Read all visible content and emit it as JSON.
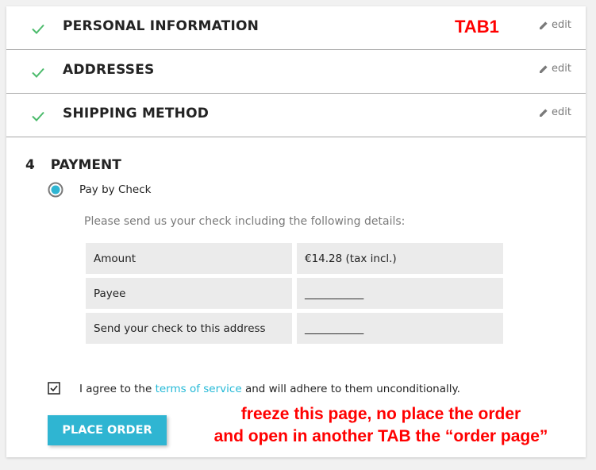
{
  "annotation": {
    "tab_label": "TAB1",
    "note_line1": "freeze this page, no place the order",
    "note_line2": "and open in another TAB the “order page”"
  },
  "steps": [
    {
      "title": "PERSONAL INFORMATION",
      "edit_label": "edit",
      "status_icon": "check-icon"
    },
    {
      "title": "ADDRESSES",
      "edit_label": "edit",
      "status_icon": "check-icon"
    },
    {
      "title": "SHIPPING METHOD",
      "edit_label": "edit",
      "status_icon": "check-icon"
    }
  ],
  "payment": {
    "number": "4",
    "title": "PAYMENT",
    "option_label": "Pay by Check",
    "option_selected": true,
    "description": "Please send us your check including the following details:",
    "details": [
      {
        "label": "Amount",
        "value": "€14.28 (tax incl.)"
      },
      {
        "label": "Payee",
        "value": "___________"
      },
      {
        "label": "Send your check to this address",
        "value": "___________"
      }
    ],
    "terms": {
      "checked": true,
      "prefix": "I agree to the",
      "link": "terms of service",
      "suffix": "and will adhere to them unconditionally."
    },
    "button_label": "PLACE ORDER"
  },
  "colors": {
    "accent": "#2fb5d2",
    "check": "#4cbb6c",
    "annotation": "#ff0000"
  }
}
